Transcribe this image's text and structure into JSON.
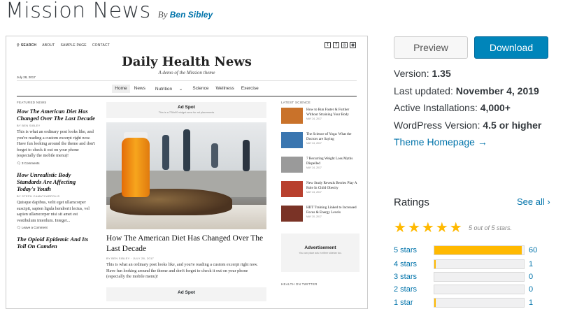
{
  "header": {
    "theme_title": "Mission News",
    "by": "By",
    "author": "Ben Sibley"
  },
  "screenshot": {
    "topnav": [
      "SEARCH",
      "ABOUT",
      "SAMPLE PAGE",
      "CONTACT"
    ],
    "site_title": "Daily Health News",
    "tagline": "A demo of the Mission theme",
    "date": "July 28, 2017",
    "nav": [
      "Home",
      "News",
      "Nutrition",
      "Science",
      "Wellness",
      "Exercise"
    ],
    "left": {
      "label": "FEATURED NEWS",
      "posts": [
        {
          "title": "How The American Diet Has Changed Over The Last Decade",
          "by": "BY BEN SIBLEY",
          "excerpt": "This is what an ordinary post looks like, and you're reading a custom excerpt right now. Have fun looking around the theme and don't forget to check it out on your phone (especially the mobile menu)!",
          "comments": "3 Comments"
        },
        {
          "title": "How Unrealistic Body Standards Are Affecting Today's Youth",
          "by": "BY STEPH CAMATCARPOLIS",
          "excerpt": "Quisque dapibus, velit eget ullamcorper suscipit, sapien ligula hendrerit lectus, vel sapien ullamcorper nisi sit amet est vestibulum interdum. Integer...",
          "comments": "Leave a Comment"
        },
        {
          "title": "The Opioid Epidemic And Its Toll On Camden",
          "by": "",
          "excerpt": "",
          "comments": ""
        }
      ]
    },
    "center": {
      "ad_title": "Ad Spot",
      "ad_sub": "This is a 728x90 widget area for ad placements",
      "post_title": "How The American Diet Has Changed Over The Last Decade",
      "post_by": "BY BEN SIBLEY · JULY 28, 2017",
      "post_excerpt": "This is what an ordinary post looks like, and you're reading a custom excerpt right now. Have fun looking around the theme and don't forget to check it out on your phone (especially the mobile menu)!",
      "ad2_title": "Ad Spot"
    },
    "right": {
      "label": "LATEST SCIENCE",
      "items": [
        {
          "title": "How to Run Faster & Further Without Straining Your Body",
          "date": "MAY 24, 2017",
          "color": "#c9722a"
        },
        {
          "title": "The Science of Yoga: What the Doctors are Saying",
          "date": "MAY 24, 2017",
          "color": "#3a76b0"
        },
        {
          "title": "7 Recurring Weight Loss Myths Dispelled",
          "date": "MAY 24, 2017",
          "color": "#9a9a9a"
        },
        {
          "title": "New Study Reveals Berries Play A Role In Child Obesity",
          "date": "MAY 24, 2017",
          "color": "#b8402e"
        },
        {
          "title": "HIIT Training Linked to Increased Focus & Energy Levels",
          "date": "MAY 20, 2017",
          "color": "#7a3326"
        }
      ],
      "adv_title": "Advertisement",
      "adv_sub": "You can place ads in either sidebar too.",
      "twitter_label": "HEALTH ON TWITTER"
    }
  },
  "actions": {
    "preview": "Preview",
    "download": "Download"
  },
  "meta": {
    "version_label": "Version:",
    "version": "1.35",
    "updated_label": "Last updated:",
    "updated": "November 4, 2019",
    "installs_label": "Active Installations:",
    "installs": "4,000+",
    "wp_label": "WordPress Version:",
    "wp": "4.5 or higher",
    "homepage": "Theme Homepage →"
  },
  "ratings": {
    "heading": "Ratings",
    "see_all": "See all",
    "average_text": "5 out of 5 stars.",
    "stars_filled": 5,
    "rows": [
      {
        "label": "5 stars",
        "count": "60",
        "fraction": 0.98
      },
      {
        "label": "4 stars",
        "count": "1",
        "fraction": 0.016
      },
      {
        "label": "3 stars",
        "count": "0",
        "fraction": 0
      },
      {
        "label": "2 stars",
        "count": "0",
        "fraction": 0
      },
      {
        "label": "1 star",
        "count": "1",
        "fraction": 0.016
      }
    ]
  },
  "colors": {
    "link": "#0073aa",
    "download_bg": "#0085ba",
    "star": "#ffb900"
  }
}
